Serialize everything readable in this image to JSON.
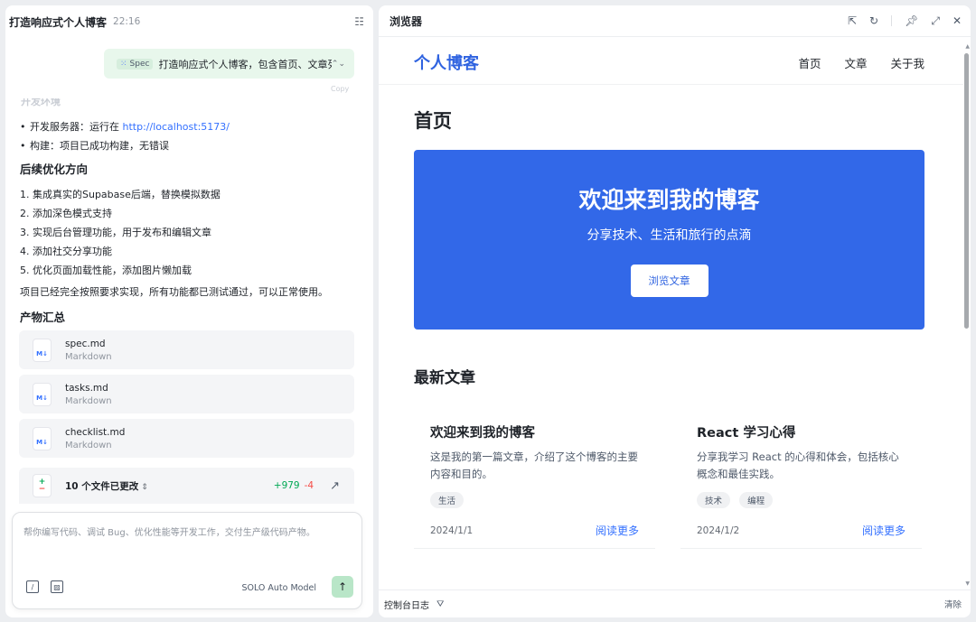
{
  "left": {
    "title": "打造响应式个人博客",
    "time": "22:16",
    "spec": {
      "tag": "Spec",
      "text": "打造响应式个人博客，包含首页、文章列"
    },
    "copy_hint": "Copy",
    "faded_heading": "开发环境",
    "bullets": [
      {
        "label": "开发服务器：运行在 ",
        "link": "http://localhost:5173/"
      },
      {
        "label": "构建：项目已成功构建，无错误",
        "link": ""
      }
    ],
    "optimize_title": "后续优化方向",
    "optimize_items": [
      "1. 集成真实的Supabase后端，替换模拟数据",
      "2. 添加深色模式支持",
      "3. 实现后台管理功能，用于发布和编辑文章",
      "4. 添加社交分享功能",
      "5. 优化页面加载性能，添加图片懒加载"
    ],
    "summary": "项目已经完全按照要求实现，所有功能都已测试通过，可以正常使用。",
    "artifacts_title": "产物汇总",
    "files": [
      {
        "name": "spec.md",
        "type": "Markdown"
      },
      {
        "name": "tasks.md",
        "type": "Markdown"
      },
      {
        "name": "checklist.md",
        "type": "Markdown"
      }
    ],
    "changes": {
      "label": "10 个文件已更改",
      "plus": "+979",
      "minus": "-4"
    },
    "composer": {
      "placeholder": "帮你编写代码、调试 Bug、优化性能等开发工作，交付生产级代码产物。",
      "model": "SOLO Auto Model"
    }
  },
  "browser": {
    "title": "浏览器",
    "site": {
      "brand": "个人博客",
      "nav": [
        "首页",
        "文章",
        "关于我"
      ],
      "page_heading": "首页",
      "hero": {
        "title": "欢迎来到我的博客",
        "subtitle": "分享技术、生活和旅行的点滴",
        "button": "浏览文章"
      },
      "latest_heading": "最新文章",
      "posts": [
        {
          "title": "欢迎来到我的博客",
          "desc": "这是我的第一篇文章，介绍了这个博客的主要内容和目的。",
          "tags": [
            "生活"
          ],
          "date": "2024/1/1",
          "more": "阅读更多"
        },
        {
          "title": "React 学习心得",
          "desc": "分享我学习 React 的心得和体会，包括核心概念和最佳实践。",
          "tags": [
            "技术",
            "编程"
          ],
          "date": "2024/1/2",
          "more": "阅读更多"
        }
      ]
    },
    "console": {
      "label": "控制台日志",
      "clear": "清除"
    }
  },
  "colors": {
    "accent": "#3268e8",
    "link": "#3370ff",
    "spec_bg": "#e8f7ec",
    "plus": "#00a854",
    "minus": "#f54a45"
  }
}
